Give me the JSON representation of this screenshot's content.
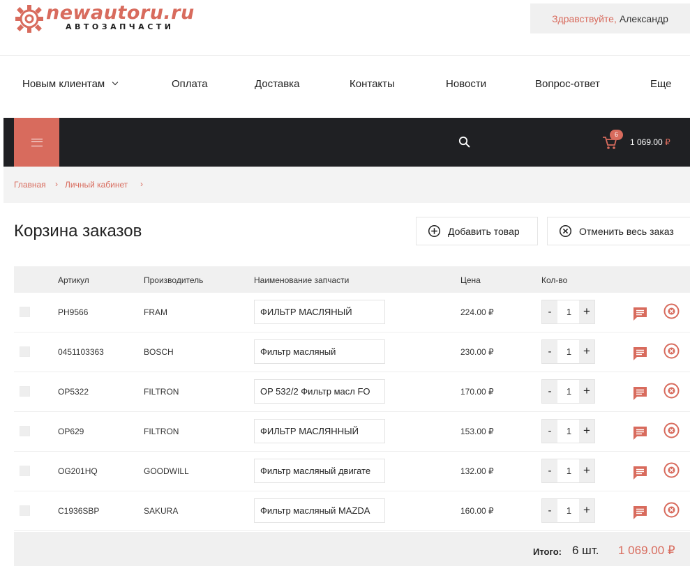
{
  "logo": {
    "name": "newautoru.ru",
    "subtitle": "АВТОЗАПЧАСТИ"
  },
  "user": {
    "greeting": "Здравствуйте,",
    "name": "Александр"
  },
  "menu": [
    {
      "label": "Новым клиентам"
    },
    {
      "label": "Оплата"
    },
    {
      "label": "Доставка"
    },
    {
      "label": "Контакты"
    },
    {
      "label": "Новости"
    },
    {
      "label": "Вопрос-ответ"
    },
    {
      "label": "Еще"
    }
  ],
  "cart": {
    "count": "6",
    "total": "1 069.00",
    "currency": "₽"
  },
  "breadcrumbs": [
    {
      "label": "Главная"
    },
    {
      "label": "Личный кабинет"
    }
  ],
  "page": {
    "title": "Корзина заказов",
    "add_label": "Добавить товар",
    "cancel_label": "Отменить весь заказ"
  },
  "table": {
    "headers": {
      "article": "Артикул",
      "maker": "Производитель",
      "name": "Наименование запчасти",
      "price": "Цена",
      "qty": "Кол-во"
    },
    "rows": [
      {
        "article": "PH9566",
        "maker": "FRAM",
        "name": "ФИЛЬТР МАСЛЯНЫЙ",
        "price": "224.00 ₽",
        "qty": "1"
      },
      {
        "article": "0451103363",
        "maker": "BOSCH",
        "name": "Фильтр масляный",
        "price": "230.00 ₽",
        "qty": "1"
      },
      {
        "article": "OP5322",
        "maker": "FILTRON",
        "name": "OP 532/2 Фильтр масл FO",
        "price": "170.00 ₽",
        "qty": "1"
      },
      {
        "article": "OP629",
        "maker": "FILTRON",
        "name": "ФИЛЬТР МАСЛЯННЫЙ",
        "price": "153.00 ₽",
        "qty": "1"
      },
      {
        "article": "OG201HQ",
        "maker": "GOODWILL",
        "name": "Фильтр масляный двигате",
        "price": "132.00 ₽",
        "qty": "1"
      },
      {
        "article": "C1936SBP",
        "maker": "SAKURA",
        "name": "Фильтр масляный MAZDA",
        "price": "160.00 ₽",
        "qty": "1"
      }
    ],
    "minus": "-",
    "plus": "+"
  },
  "summary": {
    "label": "Итого:",
    "count": "6 шт.",
    "sum": "1 069.00 ₽"
  },
  "colors": {
    "accent": "#d86b5d",
    "dark_bar": "#1f2023",
    "light_bg": "#f0f0f0"
  },
  "icons": {
    "logo": "gear-icon",
    "menu": "hamburger-icon",
    "search": "search-icon",
    "cart": "cart-icon",
    "add": "plus-circle-icon",
    "cancel": "close-circle-icon",
    "comment": "comment-icon",
    "delete": "delete-circle-icon",
    "dropdown": "chevron-down-icon"
  }
}
